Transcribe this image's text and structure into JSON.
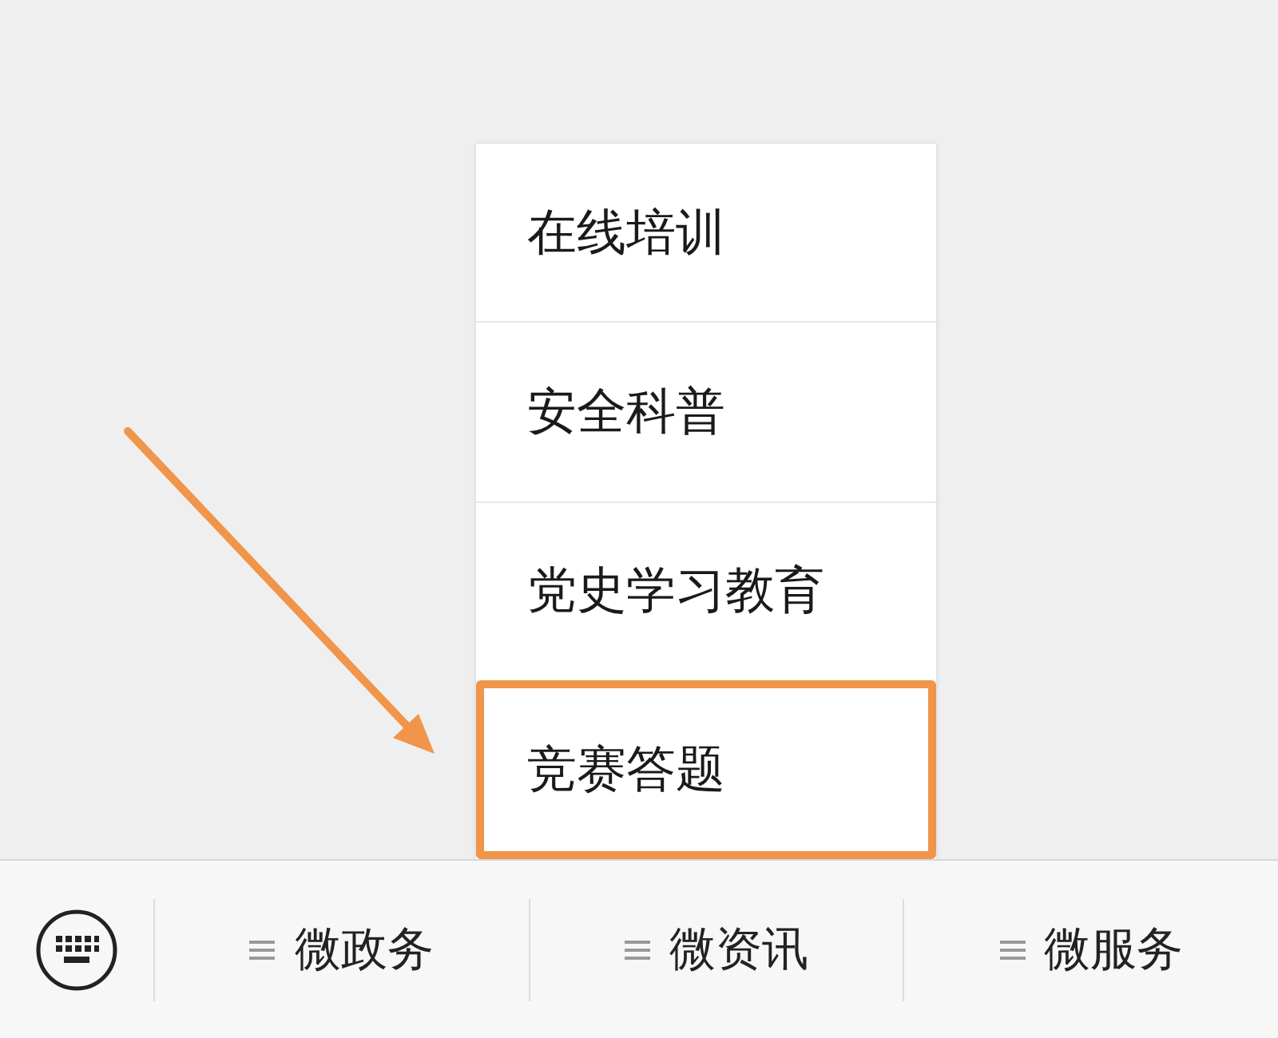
{
  "popup_menu": {
    "items": [
      {
        "label": "在线培训",
        "highlighted": false
      },
      {
        "label": "安全科普",
        "highlighted": false
      },
      {
        "label": "党史学习教育",
        "highlighted": false
      },
      {
        "label": "竞赛答题",
        "highlighted": true
      }
    ]
  },
  "bottom_menu": {
    "tabs": [
      {
        "label": "微政务"
      },
      {
        "label": "微资讯"
      },
      {
        "label": "微服务"
      }
    ]
  }
}
